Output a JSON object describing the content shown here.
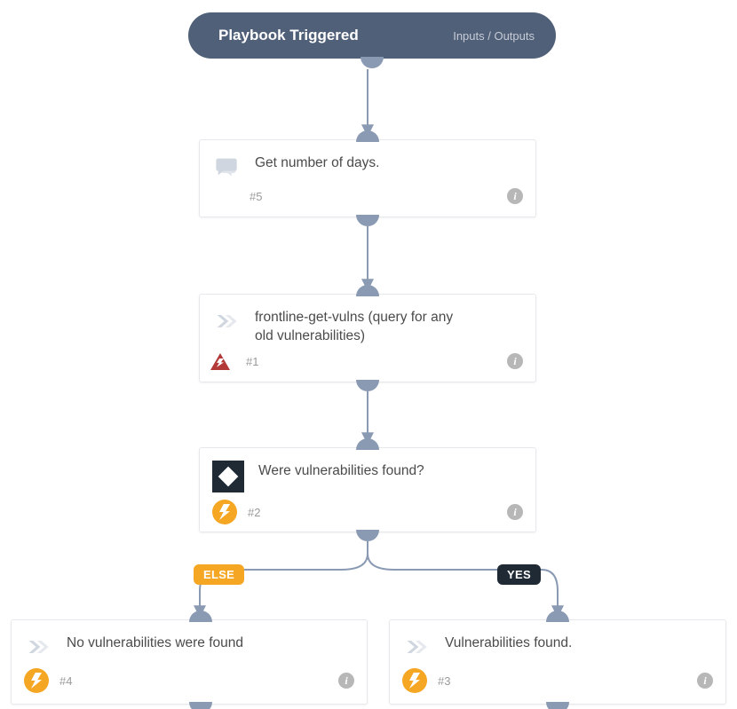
{
  "trigger": {
    "title": "Playbook Triggered",
    "io_label": "Inputs / Outputs"
  },
  "nodes": {
    "n1": {
      "label": "Get number of days.",
      "ticket": "#5"
    },
    "n2": {
      "label": "frontline-get-vulns (query for any old vulnerabilities)",
      "ticket": "#1"
    },
    "n3": {
      "label": "Were vulnerabilities found?",
      "ticket": "#2"
    },
    "n4": {
      "label": "No vulnerabilities were found",
      "ticket": "#4"
    },
    "n5": {
      "label": "Vulnerabilities found.",
      "ticket": "#3"
    }
  },
  "branches": {
    "else": "ELSE",
    "yes": "YES"
  },
  "colors": {
    "edge": "#8a9ab3",
    "accent": "#f5a623",
    "dark": "#1f2a34",
    "pill": "#506079"
  }
}
